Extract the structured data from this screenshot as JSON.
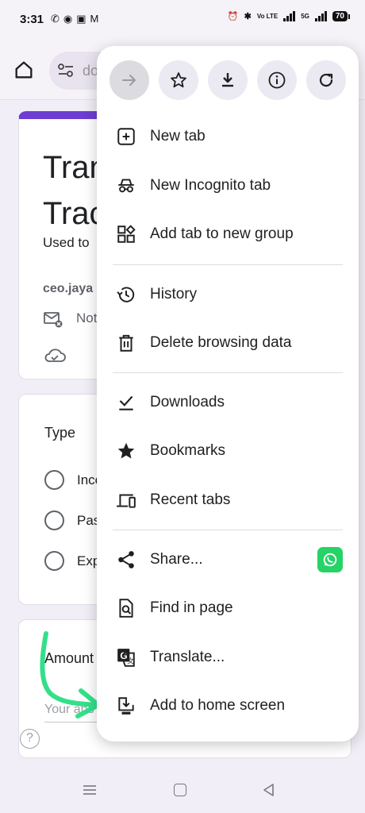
{
  "status_bar": {
    "time": "3:31",
    "volte": "Vo LTE",
    "network": "5G",
    "battery": "70"
  },
  "toolbar": {
    "omnibox_text": "do"
  },
  "page": {
    "title_line1": "Tran",
    "title_line2": "Trac",
    "description": "Used to",
    "email": "ceo.jaya",
    "not_shared": "Not",
    "type_label": "Type",
    "options": [
      "Inco",
      "Pas",
      "Exp"
    ],
    "amount_label": "Amount",
    "amount_placeholder": "Your ans",
    "help": "?"
  },
  "menu": {
    "top_buttons": [
      "forward-icon",
      "bookmark-star-icon",
      "download-icon",
      "info-icon",
      "refresh-icon"
    ],
    "items": [
      {
        "label": "New tab",
        "icon": "new-tab-icon"
      },
      {
        "label": "New Incognito tab",
        "icon": "incognito-icon"
      },
      {
        "label": "Add tab to new group",
        "icon": "tab-group-icon"
      },
      {
        "label": "History",
        "icon": "history-icon"
      },
      {
        "label": "Delete browsing data",
        "icon": "trash-icon"
      },
      {
        "label": "Downloads",
        "icon": "downloads-icon"
      },
      {
        "label": "Bookmarks",
        "icon": "star-icon"
      },
      {
        "label": "Recent tabs",
        "icon": "devices-icon"
      },
      {
        "label": "Share...",
        "icon": "share-icon"
      },
      {
        "label": "Find in page",
        "icon": "find-icon"
      },
      {
        "label": "Translate...",
        "icon": "translate-icon"
      },
      {
        "label": "Add to home screen",
        "icon": "add-to-home-icon"
      }
    ]
  },
  "colors": {
    "form_accent": "#6c3ed2",
    "whatsapp": "#25d366",
    "annotation": "#33e08a"
  }
}
